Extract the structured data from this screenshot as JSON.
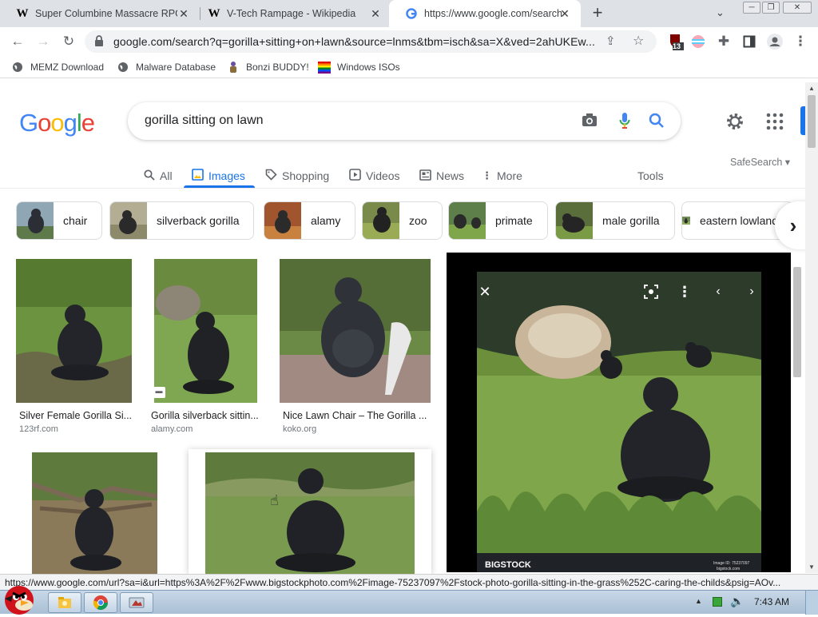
{
  "browser": {
    "tabs": [
      {
        "title": "Super Columbine Massacre RPG!",
        "favicon": "wikipedia-icon",
        "active": false
      },
      {
        "title": "V-Tech Rampage - Wikipedia",
        "favicon": "wikipedia-icon",
        "active": false
      },
      {
        "title": "https://www.google.com/search?",
        "favicon": "google-icon",
        "active": true
      }
    ],
    "new_tab_label": "+",
    "url": "google.com/search?q=gorilla+sitting+on+lawn&source=lnms&tbm=isch&sa=X&ved=2ahUKEw...",
    "extension_badge": "13",
    "bookmarks": [
      {
        "label": "MEMZ Download",
        "icon": "globe-icon"
      },
      {
        "label": "Malware Database",
        "icon": "globe-icon"
      },
      {
        "label": "Bonzi BUDDY!",
        "icon": "bonzi-icon"
      },
      {
        "label": "Windows ISOs",
        "icon": "windows-flag-icon"
      }
    ]
  },
  "google": {
    "logo_letters": [
      {
        "ch": "G",
        "color": "#4285f4"
      },
      {
        "ch": "o",
        "color": "#ea4335"
      },
      {
        "ch": "o",
        "color": "#fbbc05"
      },
      {
        "ch": "g",
        "color": "#4285f4"
      },
      {
        "ch": "l",
        "color": "#34a853"
      },
      {
        "ch": "e",
        "color": "#ea4335"
      }
    ],
    "query": "gorilla sitting on lawn",
    "nav_tabs": [
      {
        "label": "All",
        "icon": "search-icon"
      },
      {
        "label": "Images",
        "icon": "image-icon",
        "active": true
      },
      {
        "label": "Shopping",
        "icon": "tag-icon"
      },
      {
        "label": "Videos",
        "icon": "play-icon"
      },
      {
        "label": "News",
        "icon": "newspaper-icon"
      },
      {
        "label": "More",
        "icon": "more-vert-icon"
      }
    ],
    "tools_label": "Tools",
    "safesearch_label": "SafeSearch ▾",
    "chips": [
      "chair",
      "silverback gorilla",
      "alamy",
      "zoo",
      "primate",
      "male gorilla",
      "eastern lowland"
    ],
    "results": [
      {
        "caption": "Silver Female Gorilla Si...",
        "source": "123rf.com"
      },
      {
        "caption": "Gorilla silverback sittin...",
        "source": "alamy.com"
      },
      {
        "caption": "Nice Lawn Chair – The Gorilla ...",
        "source": "koko.org"
      },
      {
        "caption": "",
        "source": ""
      },
      {
        "caption": "",
        "source": ""
      }
    ],
    "preview": {
      "watermark": "BIGSTOCK",
      "image_id": "Image ID: 75237097",
      "image_site": "bigstock.com"
    }
  },
  "status_url": "https://www.google.com/url?sa=i&url=https%3A%2F%2Fwww.bigstockphoto.com%2Fimage-75237097%2Fstock-photo-gorilla-sitting-in-the-grass%252C-caring-the-childs&psig=AOv...",
  "taskbar": {
    "clock": "7:43 AM"
  },
  "colors": {
    "accent": "#1a73e8",
    "tabstrip": "#dee1e6",
    "grass": "#7fa64a"
  }
}
